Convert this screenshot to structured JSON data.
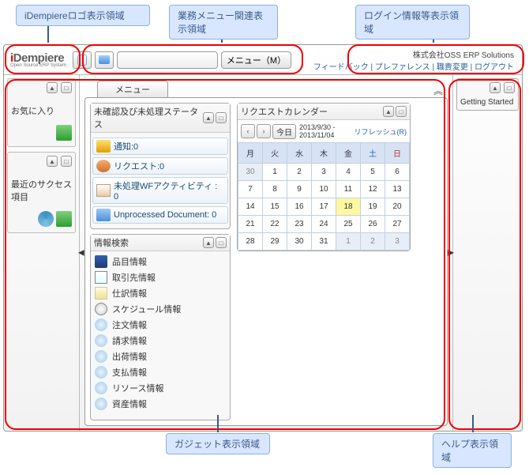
{
  "callouts": {
    "logo_region": "iDempiereロゴ表示領域",
    "menu_region": "業務メニュー関連表示領域",
    "login_region": "ログイン情報等表示領域",
    "gadget_region": "ガジェット表示領域",
    "help_region": "ヘルプ表示領域"
  },
  "header": {
    "logo_main_pre": "i",
    "logo_main_rest": "Dempiere",
    "logo_sub": "Open Source ERP System",
    "menu_button": "メニュー（M）",
    "company": "株式会社OSS ERP Solutions",
    "links": {
      "feedback": "フィードバック",
      "preference": "プレファレンス",
      "role_change": "職責変更",
      "logout": "ログアウト"
    }
  },
  "left_sidebar": {
    "favorites": "お気に入り",
    "recent": "最近のサクセス項目"
  },
  "center": {
    "tab": "メニュー",
    "workflow_panel": {
      "title": "未確認及び未処理ステータス",
      "items": [
        {
          "label": "通知:0",
          "icon": "bell"
        },
        {
          "label": "リクエスト:0",
          "icon": "user"
        },
        {
          "label": "未処理WFアクティビティ : 0",
          "icon": "flow"
        },
        {
          "label": "Unprocessed Document: 0",
          "icon": "stack"
        }
      ]
    },
    "info_panel": {
      "title": "情報検索",
      "items": [
        {
          "label": "品目情報",
          "icon": "book"
        },
        {
          "label": "取引先情報",
          "icon": "card"
        },
        {
          "label": "仕訳情報",
          "icon": "ledger"
        },
        {
          "label": "スケジュール情報",
          "icon": "clock"
        },
        {
          "label": "注文情報",
          "icon": "bulb"
        },
        {
          "label": "請求情報",
          "icon": "bulb"
        },
        {
          "label": "出荷情報",
          "icon": "bulb"
        },
        {
          "label": "支払情報",
          "icon": "bulb"
        },
        {
          "label": "リソース情報",
          "icon": "bulb"
        },
        {
          "label": "資産情報",
          "icon": "bulb"
        }
      ]
    },
    "calendar": {
      "title": "リクエストカレンダー",
      "today_btn": "今日",
      "range_from": "2013/9/30 -",
      "range_to": "2013/11/04",
      "refresh": "リフレッシュ(R)",
      "dow": [
        "月",
        "火",
        "水",
        "木",
        "金",
        "土",
        "日"
      ],
      "weeks": [
        [
          {
            "d": "30",
            "o": true
          },
          {
            "d": "1"
          },
          {
            "d": "2"
          },
          {
            "d": "3"
          },
          {
            "d": "4"
          },
          {
            "d": "5"
          },
          {
            "d": "6"
          }
        ],
        [
          {
            "d": "7"
          },
          {
            "d": "8"
          },
          {
            "d": "9"
          },
          {
            "d": "10"
          },
          {
            "d": "11"
          },
          {
            "d": "12"
          },
          {
            "d": "13"
          }
        ],
        [
          {
            "d": "14"
          },
          {
            "d": "15"
          },
          {
            "d": "16"
          },
          {
            "d": "17"
          },
          {
            "d": "18",
            "t": true
          },
          {
            "d": "19"
          },
          {
            "d": "20"
          }
        ],
        [
          {
            "d": "21"
          },
          {
            "d": "22"
          },
          {
            "d": "23"
          },
          {
            "d": "24"
          },
          {
            "d": "25"
          },
          {
            "d": "26"
          },
          {
            "d": "27"
          }
        ],
        [
          {
            "d": "28"
          },
          {
            "d": "29"
          },
          {
            "d": "30"
          },
          {
            "d": "31"
          },
          {
            "d": "1",
            "o": true
          },
          {
            "d": "2",
            "o": true
          },
          {
            "d": "3",
            "o": true
          }
        ]
      ]
    }
  },
  "right_sidebar": {
    "getting_started": "Getting Started"
  }
}
